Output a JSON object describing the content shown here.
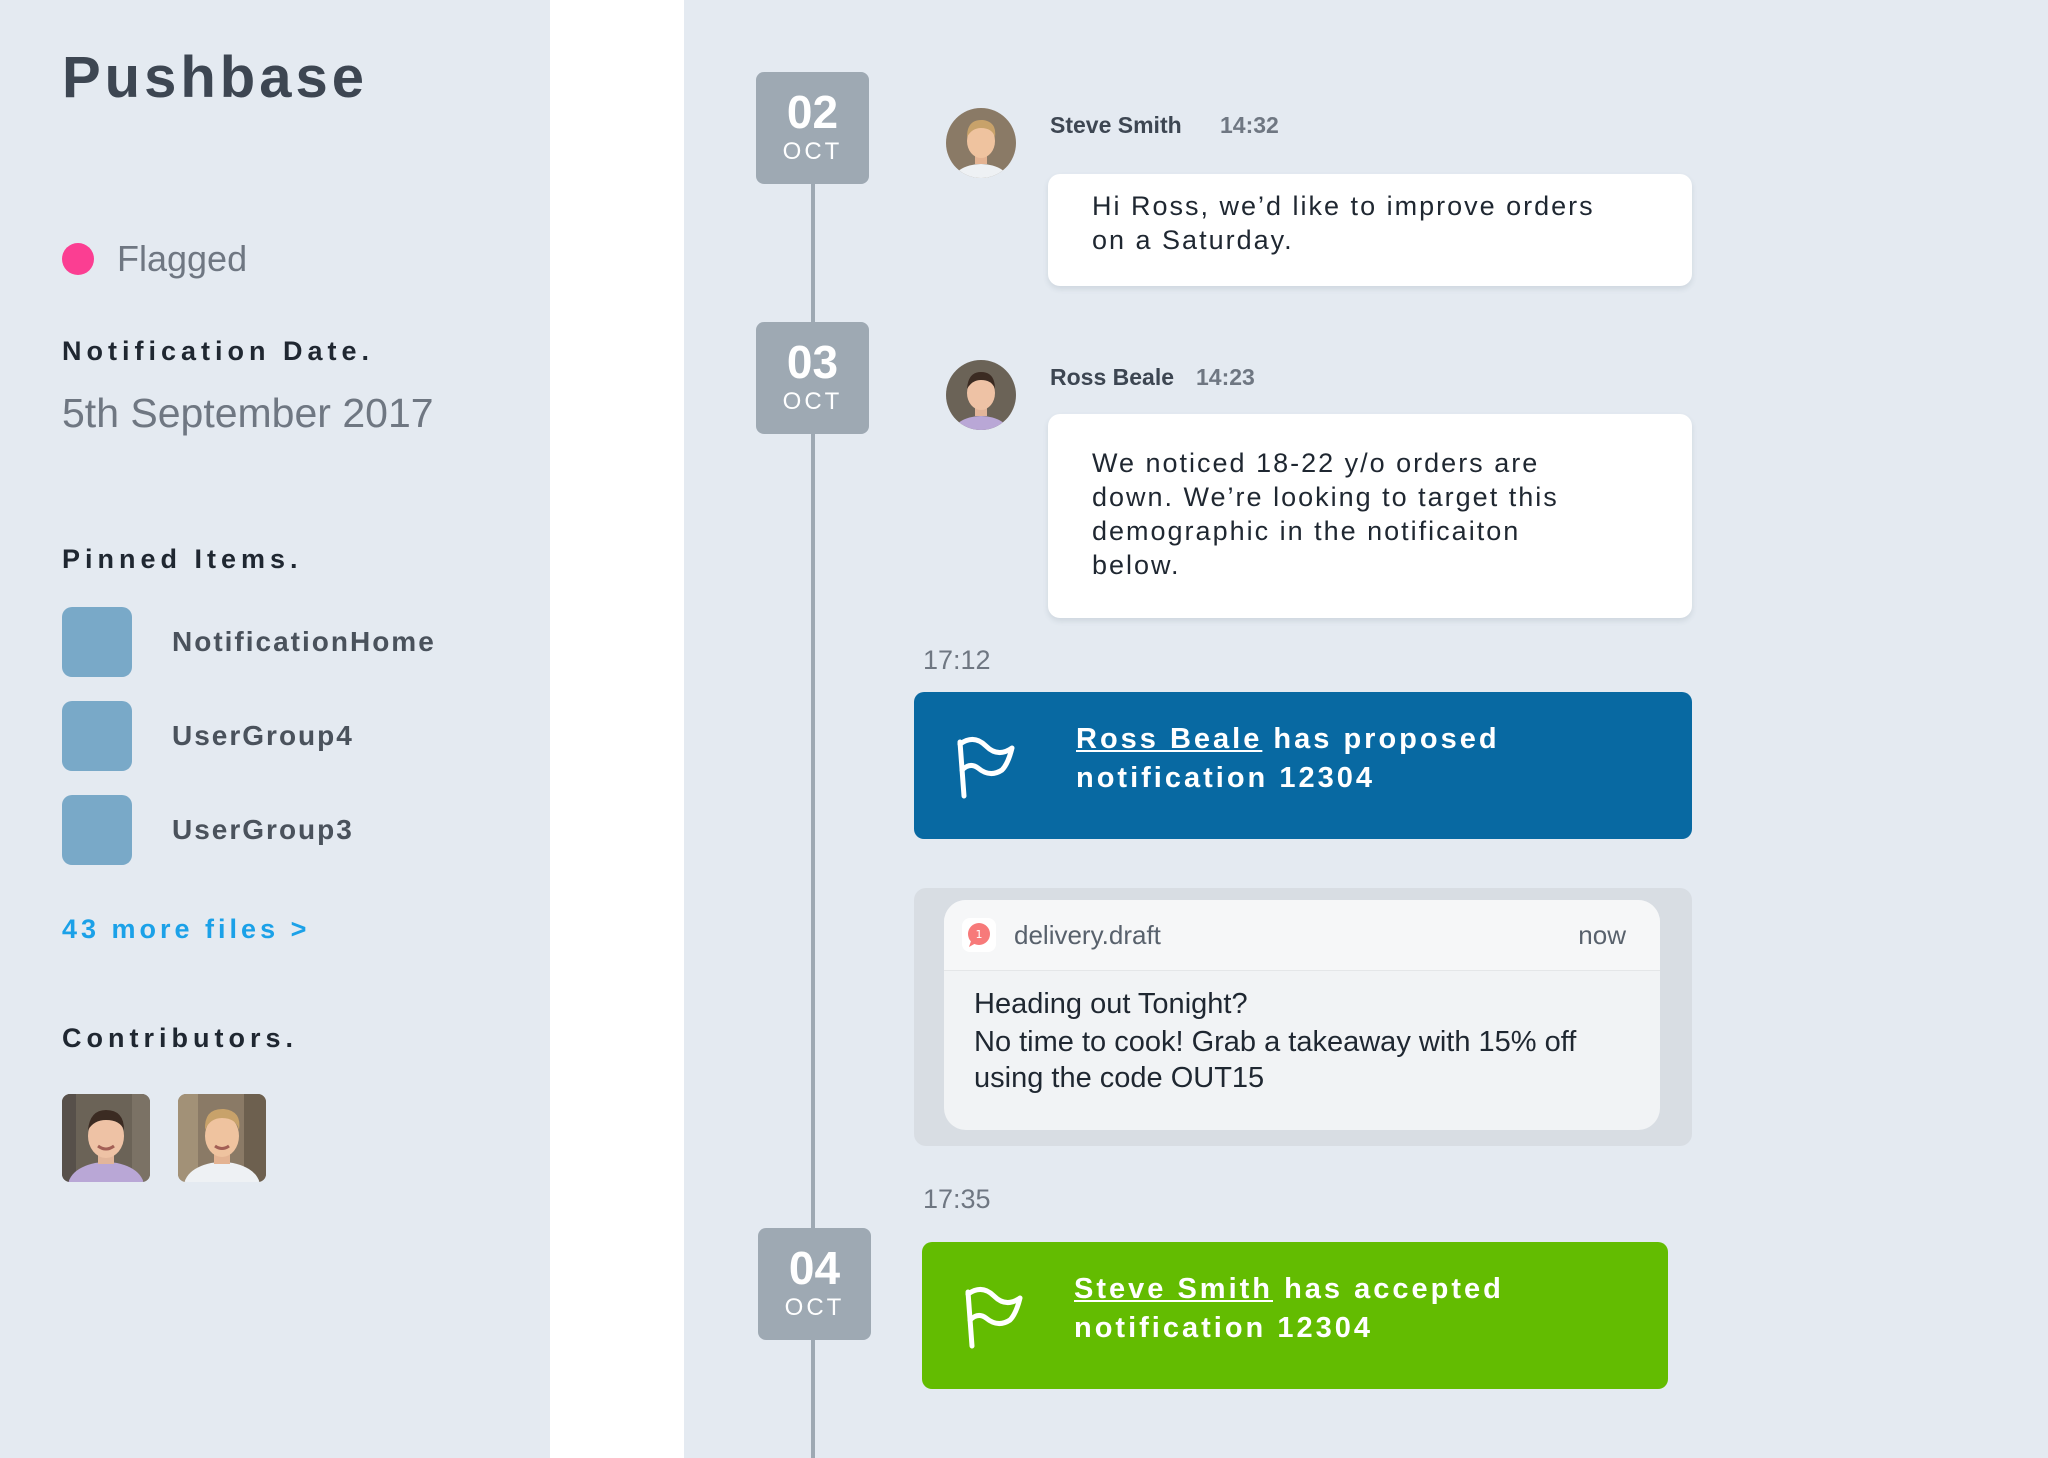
{
  "app": {
    "title": "Pushbase"
  },
  "sidebar": {
    "status": {
      "label": "Flagged",
      "color": "#fb3e92"
    },
    "notification_date": {
      "heading": "Notification Date.",
      "value": "5th September 2017"
    },
    "pinned": {
      "heading": "Pinned Items.",
      "items": [
        {
          "label": "NotificationHome"
        },
        {
          "label": "UserGroup4"
        },
        {
          "label": "UserGroup3"
        }
      ],
      "more_link": "43 more files >"
    },
    "contributors": {
      "heading": "Contributors.",
      "people": [
        {
          "name": "Ross Beale",
          "icon": "avatar"
        },
        {
          "name": "Steve Smith",
          "icon": "avatar"
        }
      ]
    }
  },
  "timeline": {
    "dates": [
      {
        "day": "02",
        "month": "OCT"
      },
      {
        "day": "03",
        "month": "OCT"
      },
      {
        "day": "04",
        "month": "OCT"
      }
    ],
    "messages": [
      {
        "author": "Steve Smith",
        "time": "14:32",
        "lines": [
          "Hi Ross, we’d like to improve orders",
          "on a Saturday."
        ]
      },
      {
        "author": "Ross Beale",
        "time": "14:23",
        "lines": [
          "We noticed 18-22 y/o orders are",
          "down. We’re looking to target this",
          "demographic in the notificaiton",
          "below."
        ]
      }
    ],
    "events": [
      {
        "time": "17:12",
        "actor": "Ross Beale",
        "action": "has proposed",
        "line2": "notification 12304",
        "color": "#0869a2",
        "icon": "flag-icon"
      },
      {
        "time": "17:35",
        "actor": "Steve Smith",
        "action": "has accepted",
        "line2": "notification 12304",
        "color": "#63bc01",
        "icon": "flag-icon"
      }
    ],
    "notification_preview": {
      "app_name": "delivery.draft",
      "when": "now",
      "title": "Heading out Tonight?",
      "body_lines": [
        "No time to cook! Grab a takeaway with 15% off",
        "using the code OUT15"
      ],
      "badge_count": "1"
    }
  }
}
